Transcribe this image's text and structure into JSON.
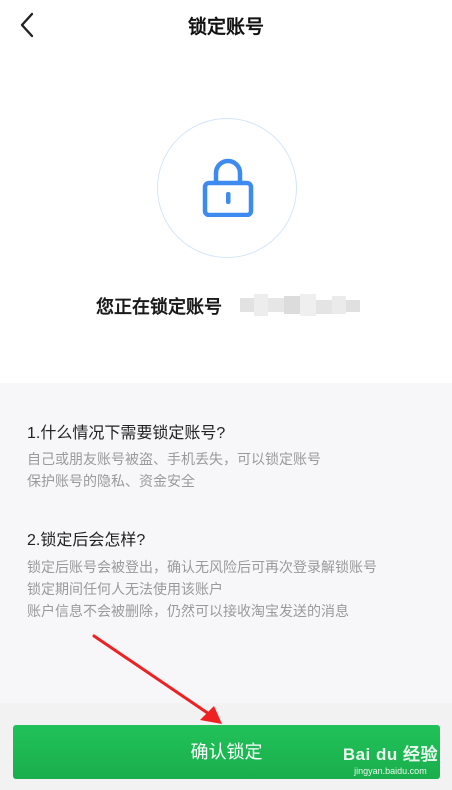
{
  "header": {
    "title": "锁定账号",
    "back_icon": "chevron-left-icon"
  },
  "hero": {
    "icon": "lock-icon",
    "icon_color": "#3d8bf0",
    "lock_text": "您正在锁定账号"
  },
  "faq": [
    {
      "question": "1.什么情况下需要锁定账号?",
      "answer_lines": [
        "自己或朋友账号被盗、手机丢失，可以锁定账号",
        "保护账号的隐私、资金安全"
      ]
    },
    {
      "question": "2.锁定后会怎样?",
      "answer_lines": [
        "锁定后账号会被登出，确认无风险后可再次登录解锁账号",
        "锁定期间任何人无法使用该账户",
        "账户信息不会被删除，仍然可以接收淘宝发送的消息"
      ]
    }
  ],
  "footer": {
    "confirm_label": "确认锁定",
    "button_color": "#1db954"
  },
  "watermark": {
    "logo": "Bai du 经验",
    "url": "jingyan.baidu.com"
  }
}
